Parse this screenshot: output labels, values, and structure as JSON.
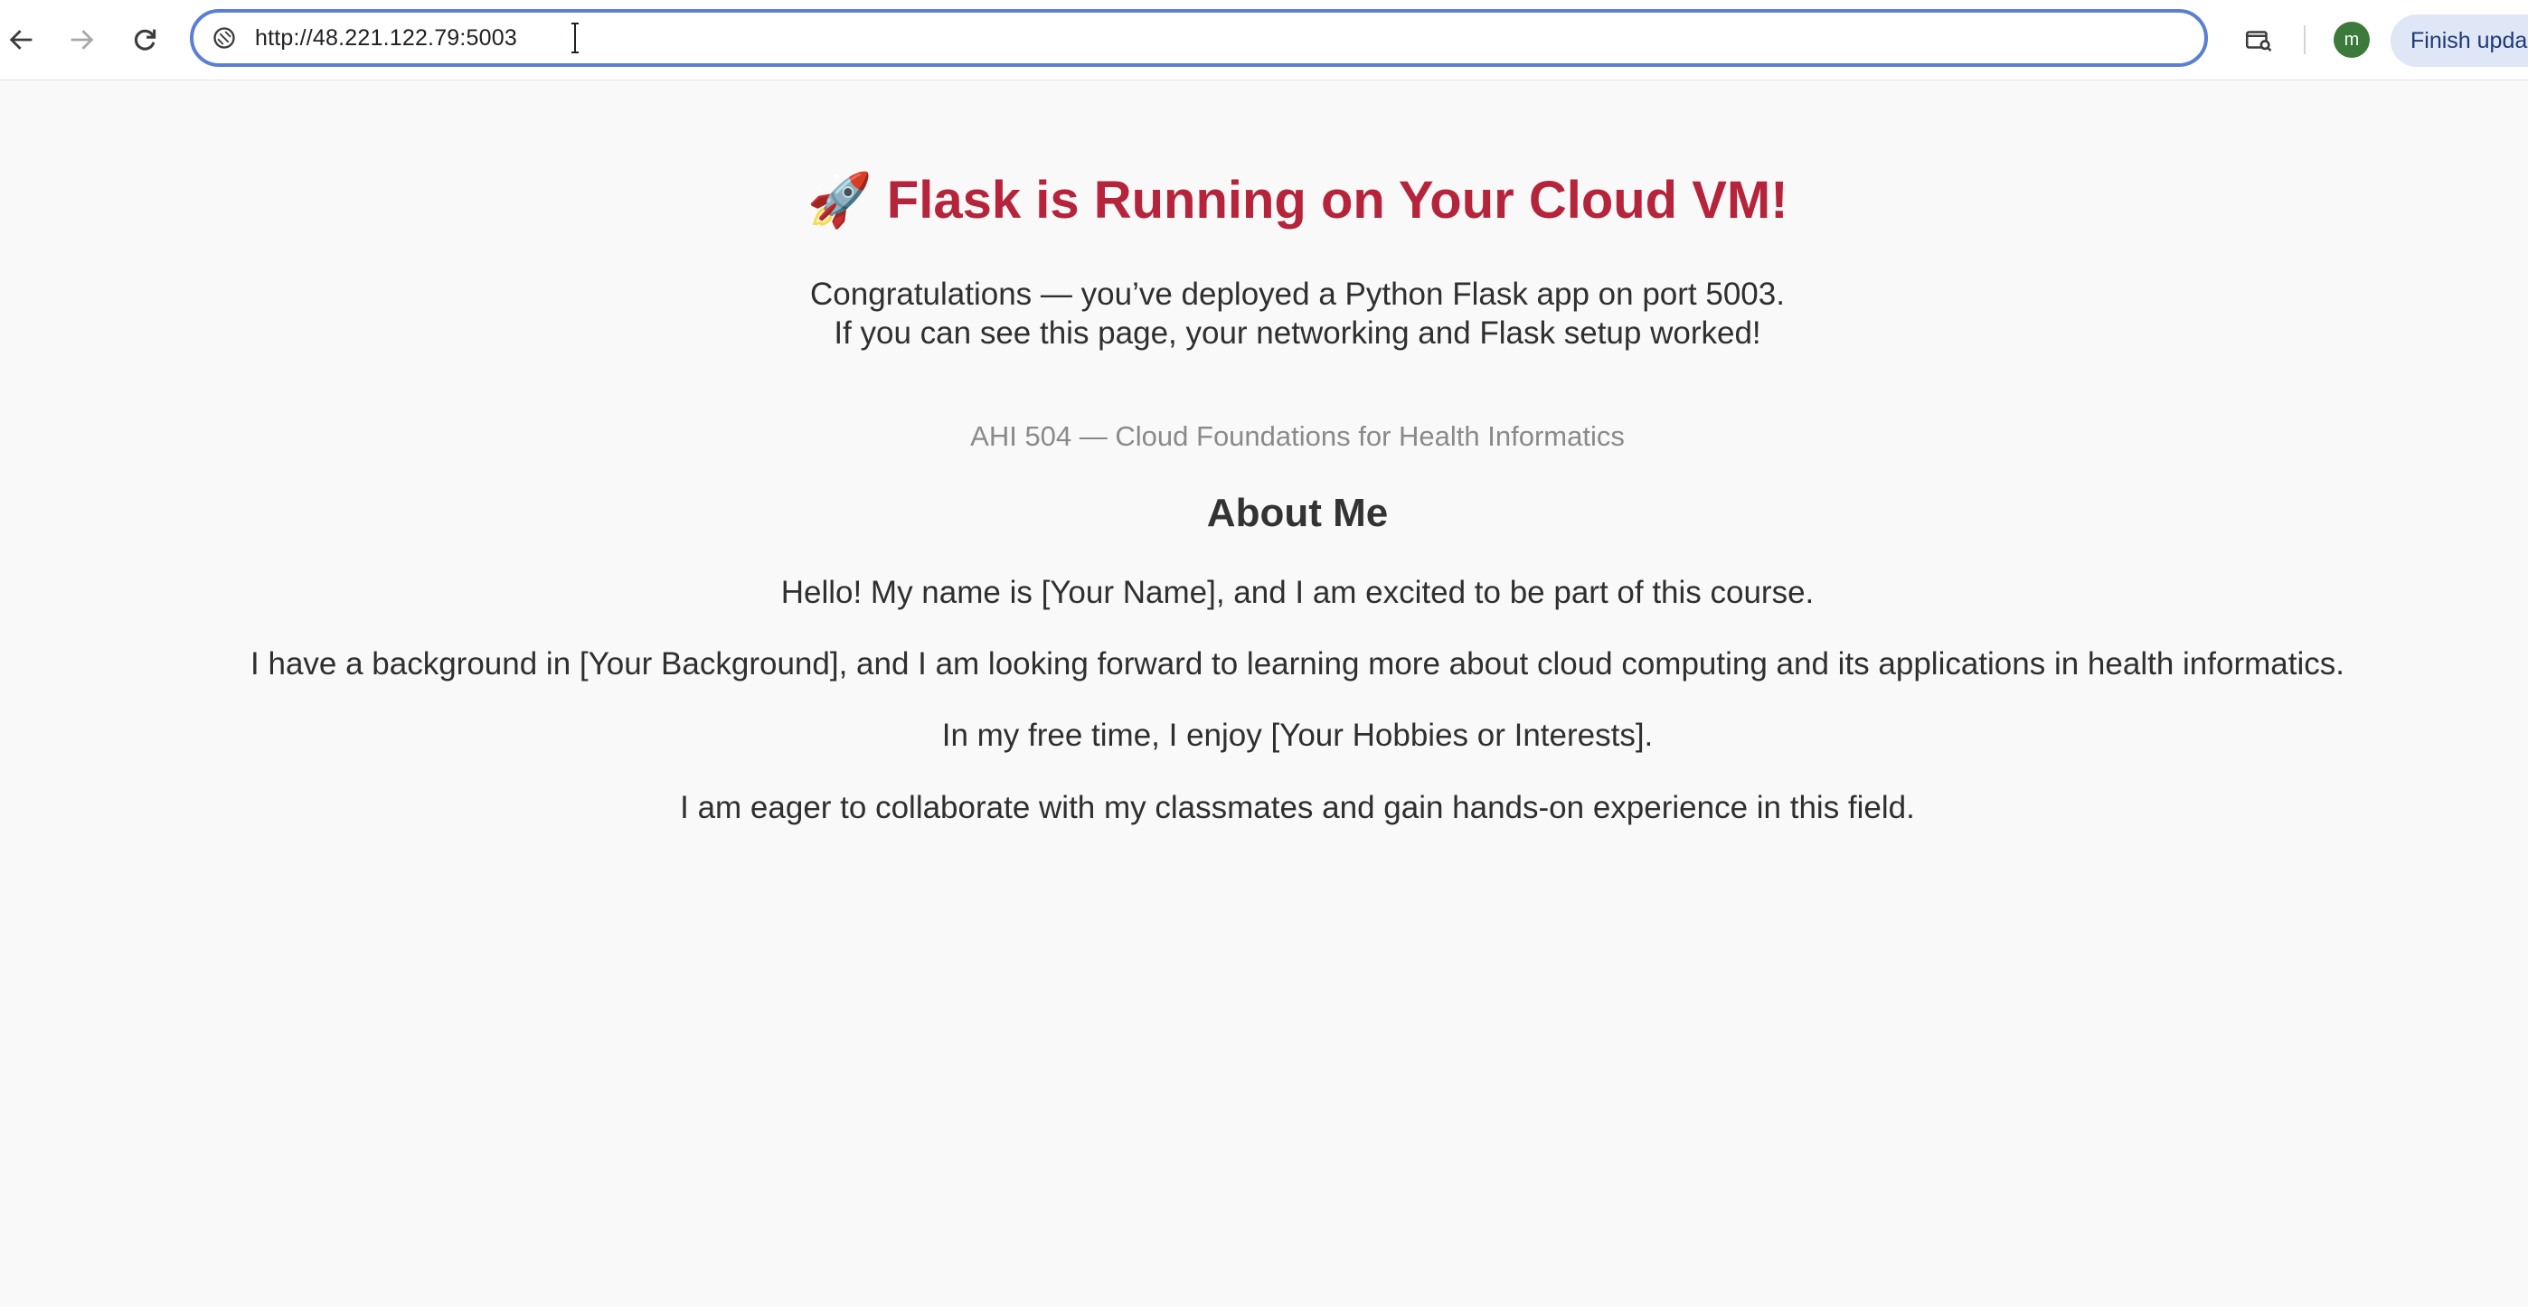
{
  "browser": {
    "url": "http://48.221.122.79:5003",
    "profile_initial": "m",
    "profile_color": "#3b7a3a",
    "update_button_label": "Finish upda",
    "icons": {
      "back": "arrow-left-icon",
      "forward": "arrow-right-icon",
      "reload": "reload-icon",
      "site_info": "site-info-icon",
      "search_tab": "tab-search-icon",
      "text_cursor": "text-cursor-icon"
    }
  },
  "page": {
    "title_emoji": "🚀",
    "title": "Flask is Running on Your Cloud VM!",
    "intro_line1": "Congratulations — you’ve deployed a Python Flask app on port 5003.",
    "intro_line2": "If you can see this page, your networking and Flask setup worked!",
    "course": "AHI 504 — Cloud Foundations for Health Informatics",
    "about_heading": "About Me",
    "paragraphs": [
      "Hello! My name is [Your Name], and I am excited to be part of this course.",
      "I have a background in [Your Background], and I am looking forward to learning more about cloud computing and its applications in health informatics.",
      "In my free time, I enjoy [Your Hobbies or Interests].",
      "I am eager to collaborate with my classmates and gain hands-on experience in this field."
    ]
  },
  "colors": {
    "title": "#b5243a",
    "omnibox_focus": "#5b7fd4",
    "page_background": "#f9f9f9"
  }
}
